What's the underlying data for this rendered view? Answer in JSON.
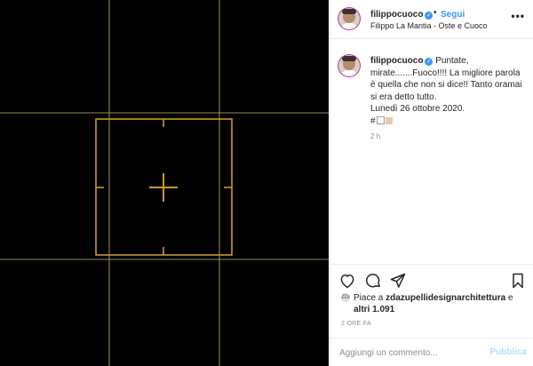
{
  "media": {
    "background": "#000000",
    "guide_color": "#d9c98a",
    "frame_color": "#c99a2e"
  },
  "header": {
    "username": "filippocuoco",
    "verified_icon": "verified-badge-icon",
    "separator": "•",
    "follow_label": "Segui",
    "subtitle": "Filippo La Mantia - Oste e Cuoco",
    "more_label": "•••"
  },
  "caption": {
    "username": "filippocuoco",
    "text": "Puntate, mirate.......Fuoco!!!! La migliore parola è quella che non si dice!! Tanto oramai si era detto tutto.",
    "date": "Lunedì 26 ottobre 2020.",
    "hashtag_prefix": "#",
    "time_ago": "2 h"
  },
  "actions": {
    "like_icon": "heart-icon",
    "comment_icon": "comment-icon",
    "share_icon": "share-icon",
    "save_icon": "bookmark-icon"
  },
  "likes": {
    "avatar_initials": "ZDI",
    "prefix": "Piace a ",
    "user": "zdazupellidesignarchitettura",
    "middle": " e",
    "others": "altri 1.091"
  },
  "post": {
    "timestamp": "2 ORE FA"
  },
  "comment": {
    "placeholder": "Aggiungi un commento...",
    "publish_label": "Pubblica"
  },
  "colors": {
    "accent": "#3897f0",
    "publish_disabled": "#b2dffc",
    "muted": "#8e8e8e"
  }
}
